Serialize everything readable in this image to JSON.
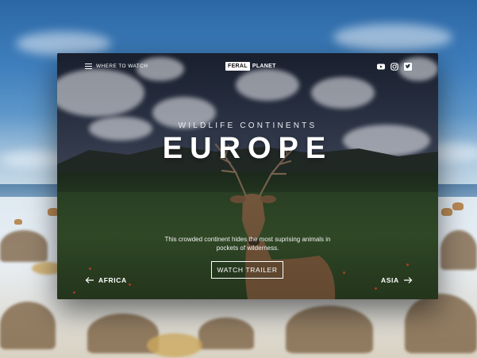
{
  "nav": {
    "menu_label": "WHERE TO WATCH",
    "menu_icon": "hamburger-menu-icon"
  },
  "brand": {
    "logo_boxed": "FERAL",
    "logo_rest": "PLANET"
  },
  "social": [
    "youtube-icon",
    "instagram-icon",
    "twitter-icon"
  ],
  "hero": {
    "eyebrow": "WILDLIFE CONTINENTS",
    "title": "EUROPE",
    "description": "This crowded continent hides the most suprising animals in pockets of wilderness.",
    "cta_label": "WATCH TRAILER"
  },
  "pager": {
    "prev_label": "AFRICA",
    "next_label": "ASIA"
  },
  "colors": {
    "text": "#ffffff",
    "logo_box_bg": "#ffffff",
    "logo_box_text": "#111111"
  }
}
